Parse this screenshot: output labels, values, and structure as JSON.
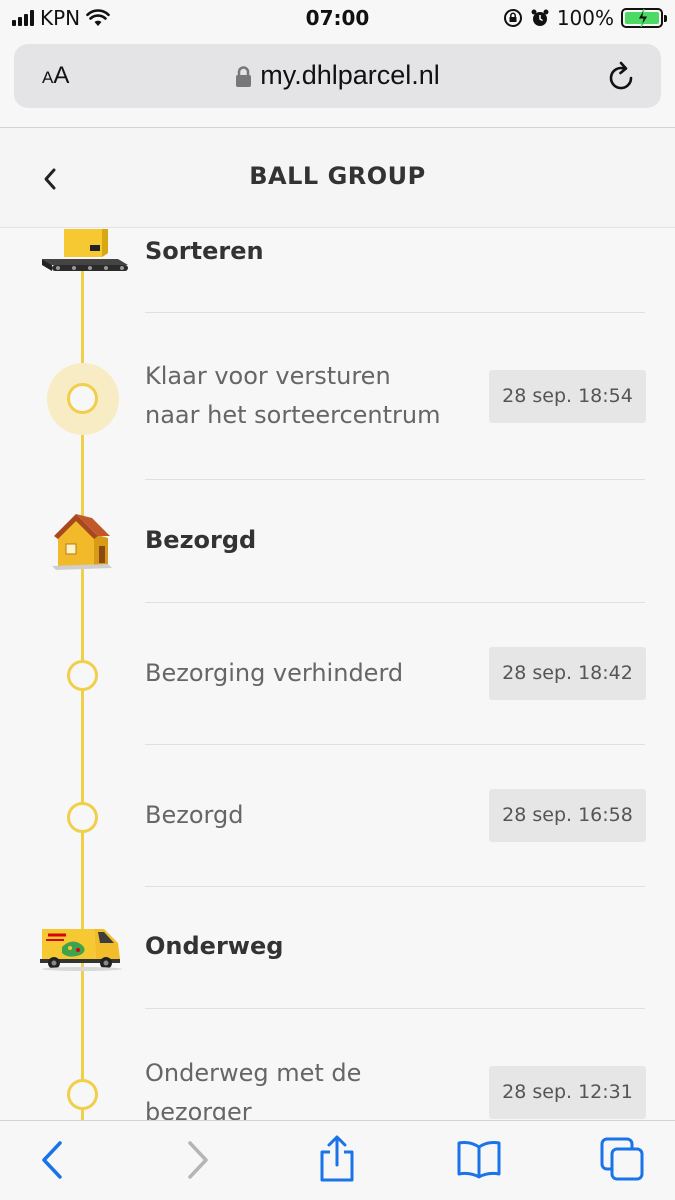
{
  "status_bar": {
    "carrier": "KPN",
    "time": "07:00",
    "battery": "100%"
  },
  "browser": {
    "text_size_small": "A",
    "text_size_large": "A",
    "url": "my.dhlparcel.nl"
  },
  "header": {
    "title": "BALL GROUP"
  },
  "timeline": {
    "sorteren": {
      "label": "Sorteren",
      "event1": {
        "line1": "Klaar voor versturen",
        "line2": "naar het sorteercentrum",
        "time": "28 sep. 18:54"
      }
    },
    "bezorgd": {
      "label": "Bezorgd",
      "event1": {
        "text": "Bezorging verhinderd",
        "time": "28 sep. 18:42"
      },
      "event2": {
        "text": "Bezorgd",
        "time": "28 sep. 16:58"
      }
    },
    "onderweg": {
      "label": "Onderweg",
      "event1": {
        "line1": "Onderweg met de",
        "line2": "bezorger",
        "time": "28 sep. 12:31"
      }
    }
  },
  "colors": {
    "timeline_line": "#f0cf4b",
    "active_halo": "#f7ecc3",
    "dhl_yellow": "#f6c933",
    "dhl_red": "#d40511",
    "browser_blue": "#1a73e8"
  },
  "icons": {
    "status": [
      "signal-icon",
      "wifi-icon",
      "orientation-lock-icon",
      "alarm-icon",
      "battery-icon"
    ],
    "toolbar": [
      "back-arrow-icon",
      "forward-arrow-icon",
      "share-icon",
      "bookmarks-icon",
      "tabs-icon"
    ]
  }
}
